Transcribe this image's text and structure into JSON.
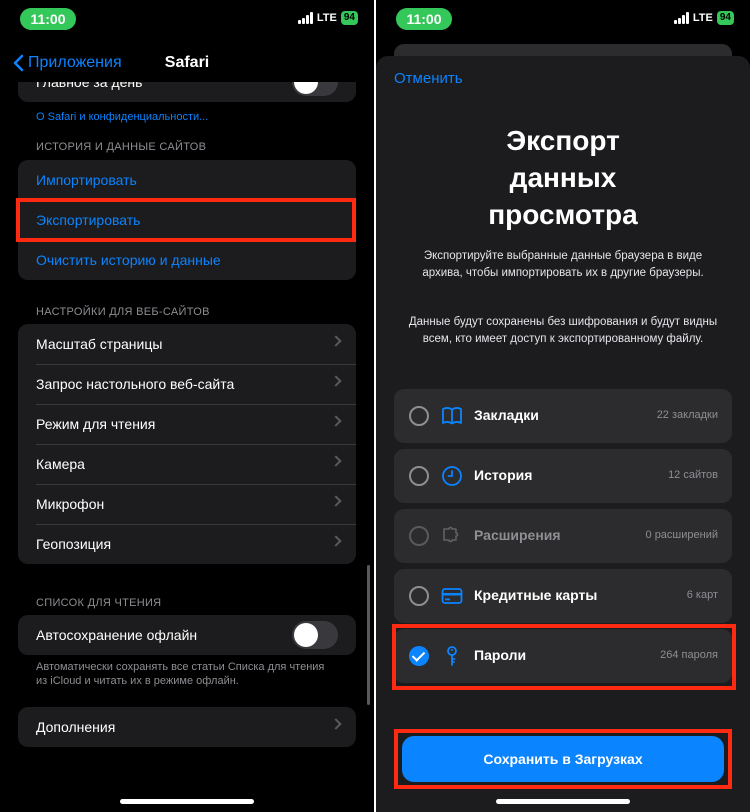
{
  "status": {
    "time": "11:00",
    "network": "LTE",
    "battery": "94"
  },
  "left": {
    "nav": {
      "back_label": "Приложения",
      "title": "Safari"
    },
    "top_row_label": "Главное за день",
    "privacy_link": "О Safari и конфиденциальности...",
    "history_header": "ИСТОРИЯ И ДАННЫЕ САЙТОВ",
    "history_items": [
      "Импортировать",
      "Экспортировать",
      "Очистить историю и данные"
    ],
    "websites_header": "НАСТРОЙКИ ДЛЯ ВЕБ-САЙТОВ",
    "website_items": [
      "Масштаб страницы",
      "Запрос настольного веб-сайта",
      "Режим для чтения",
      "Камера",
      "Микрофон",
      "Геопозиция"
    ],
    "reading_header": "СПИСОК ДЛЯ ЧТЕНИЯ",
    "offline_label": "Автосохранение офлайн",
    "offline_footnote": "Автоматически сохранять все статьи Списка для чтения из iCloud и читать их в режиме офлайн.",
    "extras_label": "Дополнения"
  },
  "right": {
    "cancel": "Отменить",
    "title": "Экспорт данных просмотра",
    "desc1": "Экспортируйте выбранные данные браузера в виде архива, чтобы импортировать их в другие браузеры.",
    "desc2": "Данные будут сохранены без шифрования и будут видны всем, кто имеет доступ к экспортированному файлу.",
    "options": [
      {
        "label": "Закладки",
        "count": "22 закладки",
        "icon": "book-icon",
        "checked": false,
        "enabled": true
      },
      {
        "label": "История",
        "count": "12 сайтов",
        "icon": "clock-icon",
        "checked": false,
        "enabled": true
      },
      {
        "label": "Расширения",
        "count": "0 расширений",
        "icon": "puzzle-icon",
        "checked": false,
        "enabled": false
      },
      {
        "label": "Кредитные карты",
        "count": "6 карт",
        "icon": "credit-card-icon",
        "checked": false,
        "enabled": true
      },
      {
        "label": "Пароли",
        "count": "264 пароля",
        "icon": "key-icon",
        "checked": true,
        "enabled": true
      }
    ],
    "save_button": "Сохранить в Загрузках"
  },
  "colors": {
    "accent": "#0a84ff",
    "highlight": "#ff2a12",
    "status_green": "#34c759"
  }
}
